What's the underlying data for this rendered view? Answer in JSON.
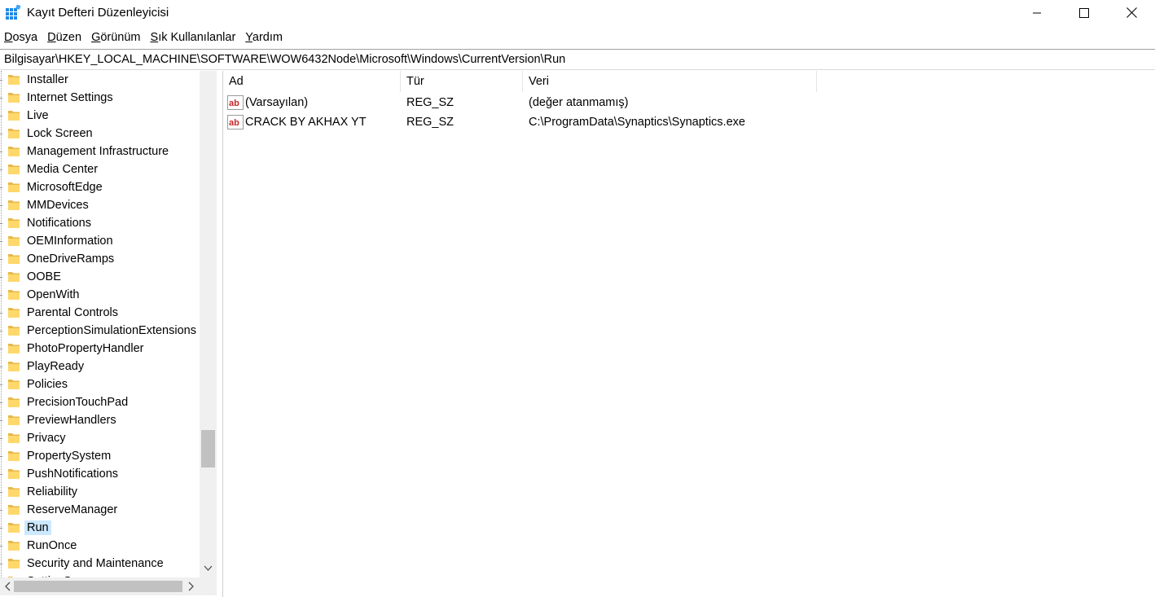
{
  "window": {
    "title": "Kayıt Defteri Düzenleyicisi",
    "icon": "registry-editor-icon",
    "controls": [
      "minimize-icon",
      "maximize-icon",
      "close-icon"
    ]
  },
  "menu": {
    "items": [
      {
        "accel": "D",
        "rest": "osya"
      },
      {
        "accel": "D",
        "rest": "üzen"
      },
      {
        "accel": "G",
        "rest": "örünüm"
      },
      {
        "accel": "S",
        "rest": "ık Kullanılanlar"
      },
      {
        "accel": "Y",
        "rest": "ardım"
      }
    ]
  },
  "address": {
    "path": "Bilgisayar\\HKEY_LOCAL_MACHINE\\SOFTWARE\\WOW6432Node\\Microsoft\\Windows\\CurrentVersion\\Run"
  },
  "tree": {
    "items": [
      "Installer",
      "Internet Settings",
      "Live",
      "Lock Screen",
      "Management Infrastructure",
      "Media Center",
      "MicrosoftEdge",
      "MMDevices",
      "Notifications",
      "OEMInformation",
      "OneDriveRamps",
      "OOBE",
      "OpenWith",
      "Parental Controls",
      "PerceptionSimulationExtensions",
      "PhotoPropertyHandler",
      "PlayReady",
      "Policies",
      "PrecisionTouchPad",
      "PreviewHandlers",
      "Privacy",
      "PropertySystem",
      "PushNotifications",
      "Reliability",
      "ReserveManager",
      "Run",
      "RunOnce",
      "Security and Maintenance",
      "SettingSync"
    ],
    "selected": "Run",
    "selection_color": "#cce8ff",
    "folder_color": "#ffd86b"
  },
  "list": {
    "columns": {
      "name": "Ad",
      "type": "Tür",
      "data": "Veri"
    },
    "rows": [
      {
        "name": "(Varsayılan)",
        "type": "REG_SZ",
        "data": "(değer atanmamış)"
      },
      {
        "name": "CRACK BY AKHAX YT",
        "type": "REG_SZ",
        "data": "C:\\ProgramData\\Synaptics\\Synaptics.exe"
      }
    ]
  }
}
